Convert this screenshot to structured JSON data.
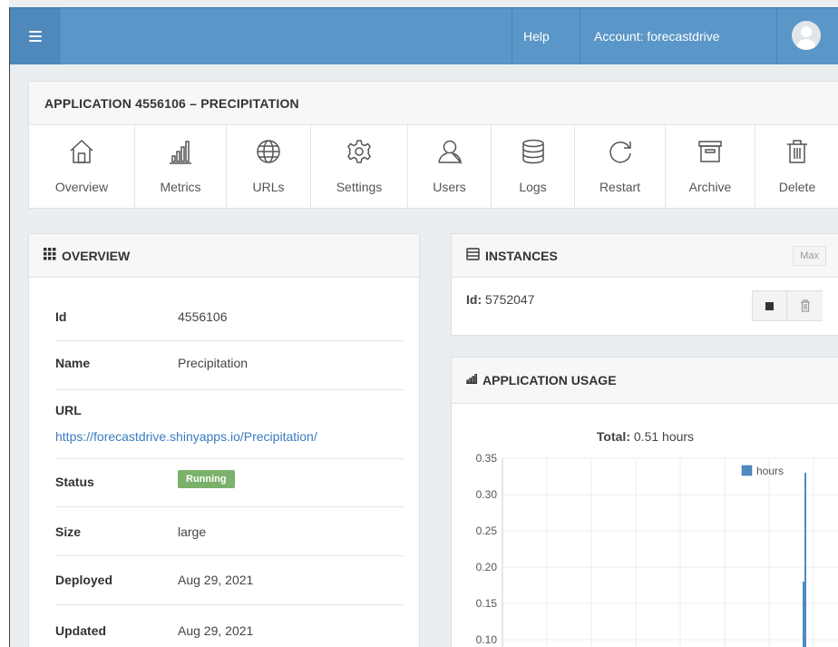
{
  "topbar": {
    "menu_icon": "hamburger-icon",
    "help_label": "Help",
    "account_label": "Account: forecastdrive",
    "avatar_icon": "user-avatar-icon"
  },
  "application": {
    "title": "APPLICATION 4556106 – PRECIPITATION",
    "toolbar": [
      {
        "label": "Overview",
        "icon": "home-icon"
      },
      {
        "label": "Metrics",
        "icon": "bar-chart-icon"
      },
      {
        "label": "URLs",
        "icon": "globe-icon"
      },
      {
        "label": "Settings",
        "icon": "gear-icon"
      },
      {
        "label": "Users",
        "icon": "user-icon"
      },
      {
        "label": "Logs",
        "icon": "database-icon"
      },
      {
        "label": "Restart",
        "icon": "restart-icon"
      },
      {
        "label": "Archive",
        "icon": "archive-icon"
      },
      {
        "label": "Delete",
        "icon": "trash-icon"
      }
    ]
  },
  "overview": {
    "title": "OVERVIEW",
    "rows": [
      {
        "key": "Id",
        "value": "4556106"
      },
      {
        "key": "Name",
        "value": "Precipitation"
      },
      {
        "key": "URL",
        "value": "https://forecastdrive.shinyapps.io/Precipitation/"
      },
      {
        "key": "Status",
        "value": "Running"
      },
      {
        "key": "Size",
        "value": "large"
      },
      {
        "key": "Deployed",
        "value": "Aug 29, 2021"
      },
      {
        "key": "Updated",
        "value": "Aug 29, 2021"
      }
    ]
  },
  "instances": {
    "title": "INSTANCES",
    "max_label": "Max",
    "id_label": "Id:",
    "id_value": "5752047"
  },
  "usage": {
    "title": "APPLICATION USAGE",
    "total_label": "Total:",
    "total_value": "0.51 hours"
  },
  "chart_data": {
    "type": "bar",
    "title": "",
    "ylim": [
      0.1,
      0.35
    ],
    "y_ticks": [
      "0.35",
      "0.30",
      "0.25",
      "0.20",
      "0.15",
      "0.10"
    ],
    "grid": true,
    "legend_position": "top-right",
    "series": [
      {
        "name": "hours",
        "color": "#4f89c3",
        "values": [
          0.18,
          0.33
        ]
      }
    ]
  }
}
